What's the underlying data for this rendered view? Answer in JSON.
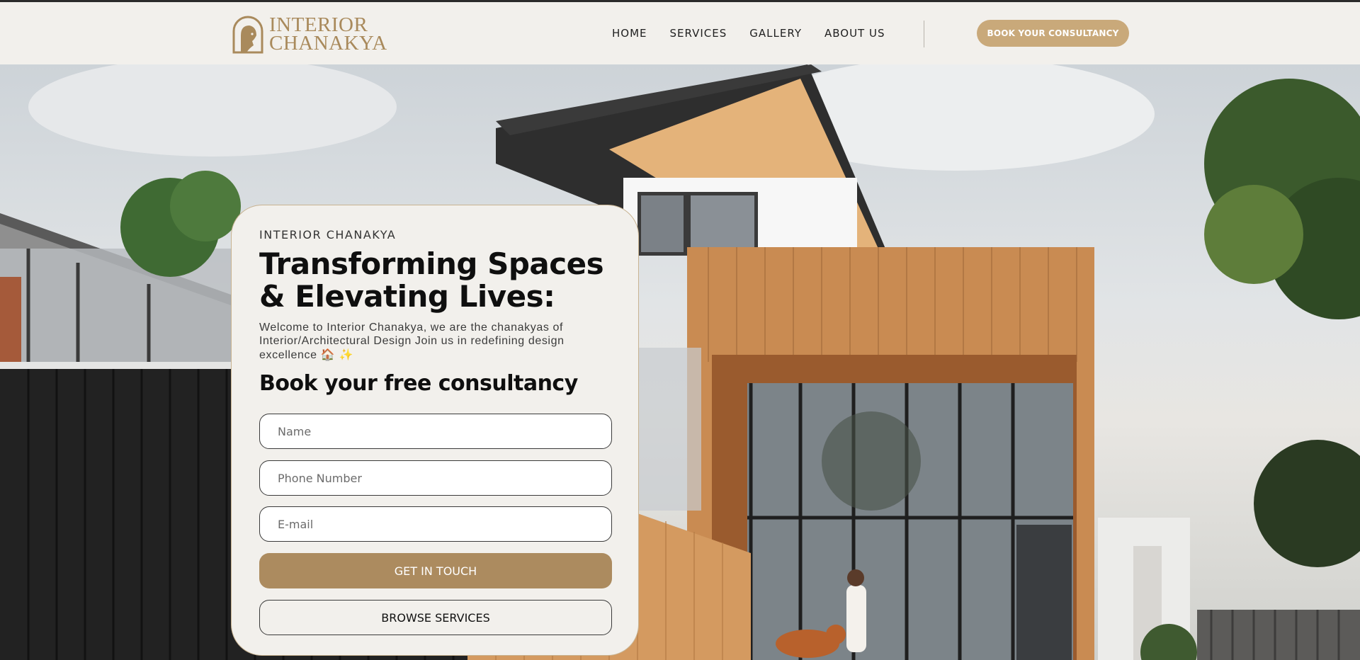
{
  "brand": {
    "line1": "INTERIOR",
    "line2": "CHANAKYA"
  },
  "nav": {
    "items": [
      {
        "label": "HOME"
      },
      {
        "label": "SERVICES"
      },
      {
        "label": "GALLERY"
      },
      {
        "label": "ABOUT US"
      }
    ],
    "cta_label": "BOOK YOUR CONSULTANCY"
  },
  "hero_card": {
    "eyebrow": "INTERIOR CHANAKYA",
    "headline": "Transforming Spaces & Elevating Lives:",
    "intro": "Welcome to Interior Chanakya, we are the chanakyas of Interior/Architectural Design Join us in redefining design excellence",
    "intro_emojis": "🏠 ✨",
    "subheading": "Book your free consultancy",
    "form": {
      "name_placeholder": "Name",
      "phone_placeholder": "Phone Number",
      "email_placeholder": "E-mail",
      "submit_label": "GET IN TOUCH",
      "browse_label": "BROWSE SERVICES"
    }
  },
  "colors": {
    "brand_gold": "#a98a5c",
    "cta_gold": "#c9a97a",
    "button_brown": "#ac8b5f",
    "background": "#f2f0ec"
  }
}
